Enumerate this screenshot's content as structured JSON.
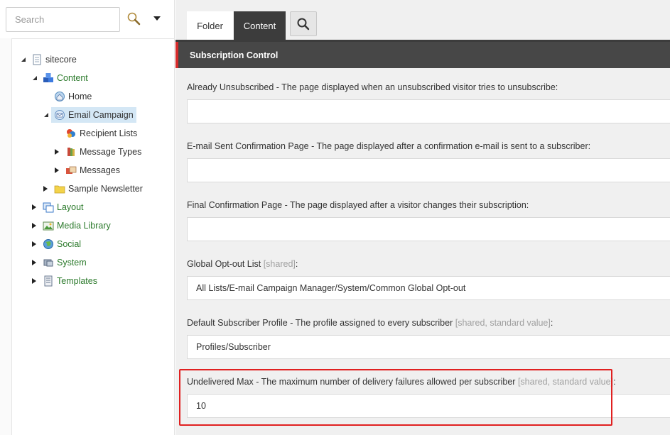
{
  "search": {
    "placeholder": "Search"
  },
  "tree": {
    "items": [
      {
        "label": "sitecore",
        "icon": "page-icon"
      },
      {
        "label": "Content",
        "icon": "content-cubes-icon"
      },
      {
        "label": "Home",
        "icon": "home-globe-icon"
      },
      {
        "label": "Email Campaign",
        "icon": "email-campaign-icon"
      },
      {
        "label": "Recipient Lists",
        "icon": "recipient-lists-icon"
      },
      {
        "label": "Message Types",
        "icon": "message-types-icon"
      },
      {
        "label": "Messages",
        "icon": "messages-icon"
      },
      {
        "label": "Sample Newsletter",
        "icon": "folder-icon"
      },
      {
        "label": "Layout",
        "icon": "layout-icon"
      },
      {
        "label": "Media Library",
        "icon": "media-library-icon"
      },
      {
        "label": "Social",
        "icon": "social-globe-icon"
      },
      {
        "label": "System",
        "icon": "system-icon"
      },
      {
        "label": "Templates",
        "icon": "templates-icon"
      }
    ]
  },
  "tabs": [
    {
      "label": "Folder"
    },
    {
      "label": "Content"
    }
  ],
  "section": {
    "title": "Subscription Control"
  },
  "fields": [
    {
      "label": "Already Unsubscribed - The page displayed when an unsubscribed visitor tries to unsubscribe:",
      "meta": "",
      "value": ""
    },
    {
      "label": "E-mail Sent Confirmation Page - The page displayed after a confirmation e-mail is sent to a subscriber:",
      "meta": "",
      "value": ""
    },
    {
      "label": "Final Confirmation Page - The page displayed after a visitor changes their subscription:",
      "meta": "",
      "value": ""
    },
    {
      "label": "Global Opt-out List ",
      "meta": "[shared]",
      "suffix": ":",
      "value": "All Lists/E-mail Campaign Manager/System/Common Global Opt-out"
    },
    {
      "label": "Default Subscriber Profile - The profile assigned to every subscriber ",
      "meta": "[shared, standard value]",
      "suffix": ":",
      "value": "Profiles/Subscriber"
    },
    {
      "label": "Undelivered Max - The maximum number of delivery failures allowed per subscriber ",
      "meta": "[shared, standard value]",
      "suffix": ":",
      "value": "10"
    }
  ],
  "colors": {
    "accent_red": "#d62b2b",
    "header_dark": "#474747",
    "tree_green": "#2b7a2b",
    "selected_bg": "#d4e7f5"
  }
}
